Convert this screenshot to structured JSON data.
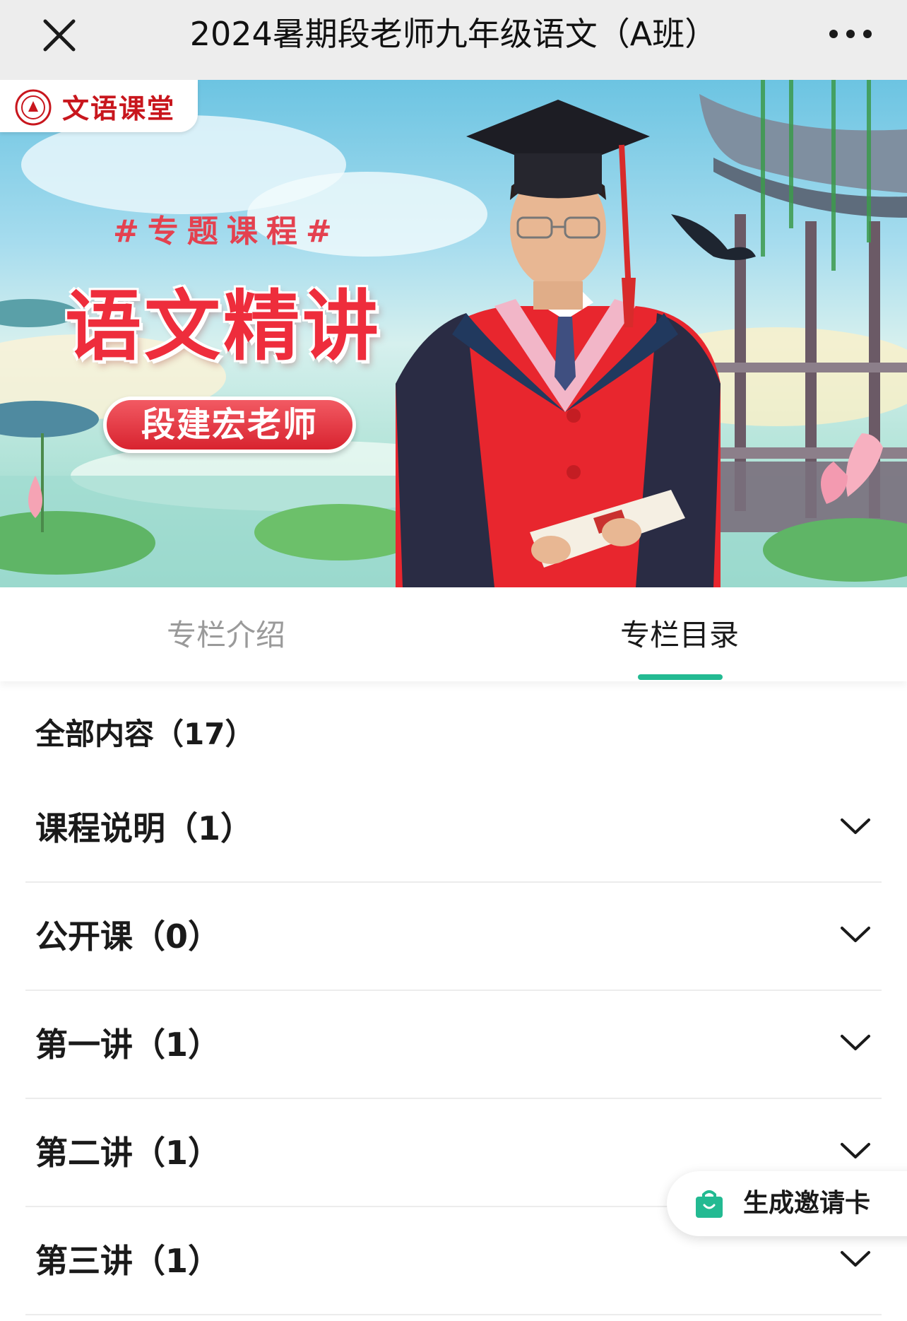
{
  "topbar": {
    "title": "2024暑期段老师九年级语文（A班）",
    "close_icon": "close-icon",
    "more_icon": "more-dots-icon"
  },
  "banner": {
    "brand_name": "文语课堂",
    "topic_line": "#专题课程#",
    "main_title": "语文精讲",
    "teacher_name": "段建宏老师",
    "colors": {
      "accent_red": "#ee2d3c",
      "sky": "#a6dcee",
      "water": "#8ed3c6"
    }
  },
  "tabs": [
    {
      "label": "专栏介绍",
      "active": false
    },
    {
      "label": "专栏目录",
      "active": true
    }
  ],
  "accent_color": "#23ba92",
  "catalog": {
    "all_label": "全部内容（17）",
    "sections": [
      {
        "label": "课程说明（1）"
      },
      {
        "label": "公开课（0）"
      },
      {
        "label": "第一讲（1）"
      },
      {
        "label": "第二讲（1）"
      },
      {
        "label": "第三讲（1）"
      }
    ]
  },
  "invite_button": {
    "label": "生成邀请卡",
    "icon": "shopping-bag-icon"
  }
}
